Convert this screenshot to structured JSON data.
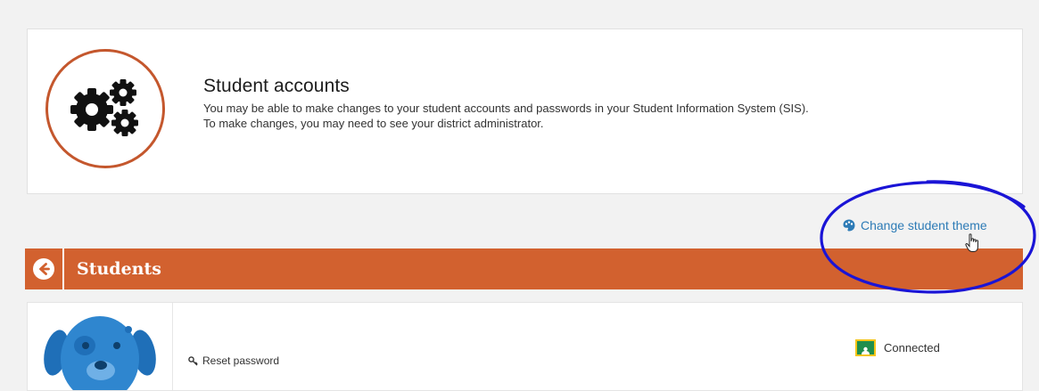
{
  "accounts_card": {
    "title": "Student accounts",
    "line1": "You may be able to make changes to your student accounts and passwords in your Student Information System (SIS).",
    "line2": "To make changes, you may need to see your district administrator."
  },
  "theme_link": {
    "label": "Change student theme"
  },
  "students_bar": {
    "title": "Students"
  },
  "student_row": {
    "reset_label": "Reset password",
    "status_label": "Connected"
  },
  "colors": {
    "accent_orange": "#d2612f",
    "badge_ring": "#c4572d",
    "link_blue": "#2d7bb6",
    "annotation_blue": "#1a14d6",
    "avatar_blue": "#2f86cf"
  }
}
